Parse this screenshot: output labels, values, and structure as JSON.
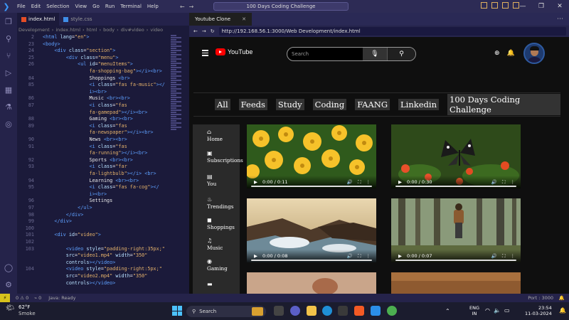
{
  "titlebar": {
    "menu": [
      "File",
      "Edit",
      "Selection",
      "View",
      "Go",
      "Run",
      "Terminal",
      "Help"
    ],
    "command_center": "100 Days Coding Challenge"
  },
  "editor": {
    "tabs": [
      {
        "label": "index.html",
        "active": true
      },
      {
        "label": "style.css",
        "active": false
      }
    ],
    "breadcrumb": [
      "Development",
      "index.html",
      "html",
      "body",
      "div#video",
      "video"
    ],
    "lines": [
      {
        "n": "2",
        "html": "<span class='tag'>&lt;html</span> <span class='attr'>lang</span>=<span class='str'>\"en\"</span><span class='tag'>&gt;</span>"
      },
      {
        "n": "23",
        "html": "<span class='tag'>&lt;body&gt;</span>"
      },
      {
        "n": "24",
        "html": "    <span class='tag'>&lt;div</span> <span class='attr'>class</span>=<span class='str'>\"section\"</span><span class='tag'>&gt;</span>"
      },
      {
        "n": "25",
        "html": "        <span class='tag'>&lt;div</span> <span class='attr'>class</span>=<span class='str'>\"menu\"</span><span class='tag'>&gt;</span>"
      },
      {
        "n": "26",
        "html": "            <span class='tag'>&lt;ul</span> <span class='attr'>id</span>=<span class='str'>\"menuItems\"</span><span class='tag'>&gt;</span>"
      },
      {
        "n": "",
        "html": "                <span class='str'>fa-shopping-bag\"</span><span class='tag'>&gt;&lt;/i&gt;&lt;br&gt;</span>"
      },
      {
        "n": "84",
        "html": "                <span class='txt'>Shoppings </span><span class='tag'>&lt;br&gt;</span>"
      },
      {
        "n": "85",
        "html": "                <span class='tag'>&lt;i</span> <span class='attr'>class</span>=<span class='str'>\"fas fa-music\"</span><span class='tag'>&gt;&lt;/</span>"
      },
      {
        "n": "",
        "html": "                <span class='tag'>i&gt;&lt;br&gt;</span>"
      },
      {
        "n": "86",
        "html": "                <span class='txt'>Music </span><span class='tag'>&lt;br&gt;&lt;br&gt;</span>"
      },
      {
        "n": "87",
        "html": "                <span class='tag'>&lt;i</span> <span class='attr'>class</span>=<span class='str'>\"fas</span>"
      },
      {
        "n": "",
        "html": "                <span class='str'>fa-gamepad\"</span><span class='tag'>&gt;&lt;/i&gt;&lt;br&gt;</span>"
      },
      {
        "n": "88",
        "html": "                <span class='txt'>Gaming </span><span class='tag'>&lt;br&gt;&lt;br&gt;</span>"
      },
      {
        "n": "89",
        "html": "                <span class='tag'>&lt;i</span> <span class='attr'>class</span>=<span class='str'>\"fas</span>"
      },
      {
        "n": "",
        "html": "                <span class='str'>fa-newspaper\"</span><span class='tag'>&gt;&lt;/i&gt;&lt;br&gt;</span>"
      },
      {
        "n": "90",
        "html": "                <span class='txt'>News </span><span class='tag'>&lt;br&gt;&lt;br&gt;</span>"
      },
      {
        "n": "91",
        "html": "                <span class='tag'>&lt;i</span> <span class='attr'>class</span>=<span class='str'>\"fas</span>"
      },
      {
        "n": "",
        "html": "                <span class='str'>fa-running\"</span><span class='tag'>&gt;&lt;/i&gt;&lt;br&gt;</span>"
      },
      {
        "n": "92",
        "html": "                <span class='txt'>Sports </span><span class='tag'>&lt;br&gt;&lt;br&gt;</span>"
      },
      {
        "n": "93",
        "html": "                <span class='tag'>&lt;i</span> <span class='attr'>class</span>=<span class='str'>\"far</span>"
      },
      {
        "n": "",
        "html": "                <span class='str'>fa-lightbulb\"</span><span class='tag'>&gt;&lt;/i&gt; &lt;br&gt;</span>"
      },
      {
        "n": "94",
        "html": "                <span class='txt'>Learning </span><span class='tag'>&lt;br&gt;&lt;br&gt;</span>"
      },
      {
        "n": "95",
        "html": "                <span class='tag'>&lt;i</span> <span class='attr'>class</span>=<span class='str'>\"fas fa-cog\"</span><span class='tag'>&gt;&lt;/</span>"
      },
      {
        "n": "",
        "html": "                <span class='tag'>i&gt;&lt;br&gt;</span>"
      },
      {
        "n": "96",
        "html": "                <span class='txt'>Settings</span>"
      },
      {
        "n": "97",
        "html": "            <span class='tag'>&lt;/ul&gt;</span>"
      },
      {
        "n": "98",
        "html": "        <span class='tag'>&lt;/div&gt;</span>"
      },
      {
        "n": "99",
        "html": "    <span class='tag'>&lt;/div&gt;</span>"
      },
      {
        "n": "100",
        "html": ""
      },
      {
        "n": "101",
        "html": "    <span class='tag'>&lt;div</span> <span class='attr'>id</span>=<span class='str'>\"video\"</span><span class='tag'>&gt;</span>"
      },
      {
        "n": "102",
        "html": ""
      },
      {
        "n": "103",
        "html": "        <span class='tag'>&lt;video</span> <span class='attr'>style</span>=<span class='str'>\"padding-right:35px;\"</span>"
      },
      {
        "n": "",
        "html": "        <span class='attr'>src</span>=<span class='str'>\"video1.mp4\"</span> <span class='attr'>width</span>=<span class='str'>\"350\"</span>"
      },
      {
        "n": "",
        "html": "        <span class='attr'>controls</span><span class='tag'>&gt;&lt;/video&gt;</span>"
      },
      {
        "n": "104",
        "html": "        <span class='tag'>&lt;video</span> <span class='attr'>style</span>=<span class='str'>\"padding-right:5px;\"</span>"
      },
      {
        "n": "",
        "html": "        <span class='attr'>src</span>=<span class='str'>\"video2.mp4\"</span> <span class='attr'>width</span>=<span class='str'>\"350\"</span>"
      },
      {
        "n": "",
        "html": "        <span class='attr'>controls</span><span class='tag'>&gt;&lt;/video&gt;</span>"
      }
    ]
  },
  "browser": {
    "tab_title": "Youtube Clone",
    "url": "http://192.168.56.1:3000/Web Development/index.html"
  },
  "youtube": {
    "logo_text": "YouTube",
    "search_placeholder": "Search",
    "chips": [
      "All",
      "Feeds",
      "Study",
      "Coding",
      "FAANG",
      "Linkedin",
      "100 Days Coding Challenge"
    ],
    "sidebar": [
      {
        "icon": "home-icon",
        "glyph": "⌂",
        "label": "Home"
      },
      {
        "icon": "subscriptions-icon",
        "glyph": "▣",
        "label": "Subscriptions"
      },
      {
        "icon": "you-icon",
        "glyph": "▤",
        "label": "You"
      },
      {
        "icon": "trending-icon",
        "glyph": "♨",
        "label": "Trendings"
      },
      {
        "icon": "shopping-bag-icon",
        "glyph": "◼",
        "label": "Shoppings"
      },
      {
        "icon": "music-icon",
        "glyph": "♫",
        "label": "Music"
      },
      {
        "icon": "gamepad-icon",
        "glyph": "◉",
        "label": "Gaming"
      }
    ],
    "videos": [
      {
        "name": "yellow-flowers",
        "time": "0:00 / 0:11"
      },
      {
        "name": "butterfly",
        "time": "0:00 / 0:30"
      },
      {
        "name": "ocean-rocks",
        "time": "0:00 / 0:08"
      },
      {
        "name": "forest-hiker",
        "time": "0:00 / 0:07"
      }
    ]
  },
  "statusbar": {
    "problems": "0 ⚠ 0",
    "ports": "0",
    "java": "Java: Ready",
    "port": "Port : 3000"
  },
  "taskbar": {
    "weather_temp": "62°F",
    "weather_desc": "Smoke",
    "search": "Search",
    "lang1": "ENG",
    "lang2": "IN",
    "time": "23:54",
    "date": "11-03-2024"
  }
}
